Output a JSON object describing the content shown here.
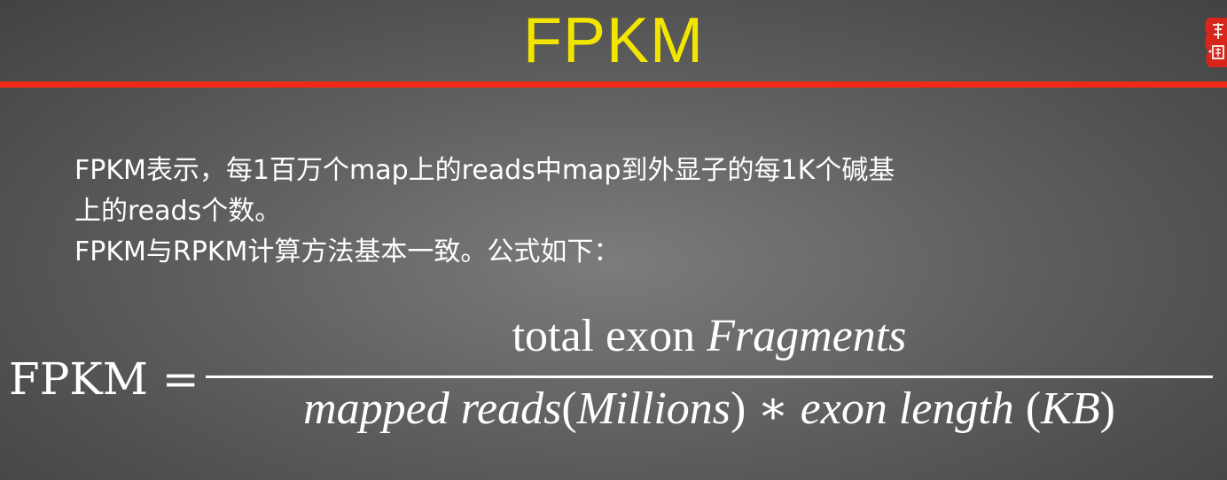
{
  "slide": {
    "title": "FPKM",
    "title_color": "#f2e600",
    "rule_color": "#ef2a18",
    "seal_icon": "red-seal-logo"
  },
  "body": {
    "lines": [
      "FPKM表示，每1百万个map上的reads中map到外显子的每1K个碱基",
      "上的reads个数。",
      "FPKM与RPKM计算方法基本一致。公式如下："
    ]
  },
  "formula": {
    "lhs": "FPKM",
    "equals": "=",
    "numerator_plain": "total exon",
    "numerator_italic": "Fragments",
    "denominator_italic_1": "mapped reads",
    "denominator_paren_open": "(",
    "denominator_italic_2": "Millions",
    "denominator_paren_close": ")",
    "denominator_operator": "∗",
    "denominator_italic_3": "exon length",
    "denominator_unit_open": "(",
    "denominator_unit": "KB",
    "denominator_unit_close": ")"
  }
}
